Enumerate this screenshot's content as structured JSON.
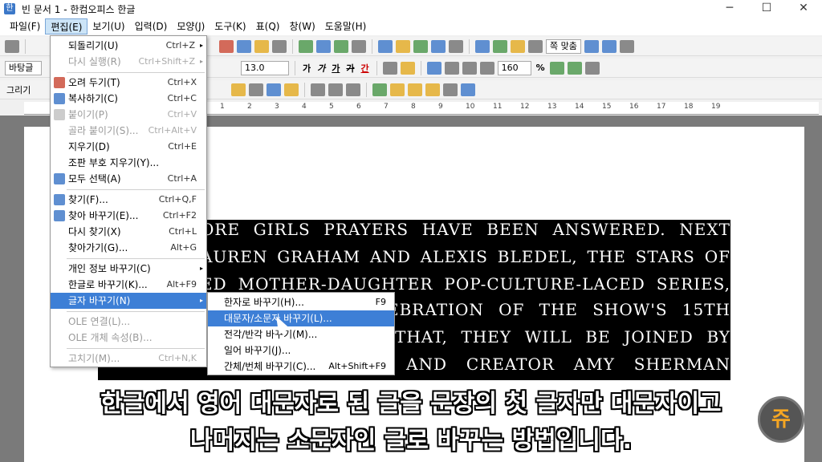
{
  "window": {
    "title": "빈 문서 1 - 한컴오피스 한글",
    "minimize": "─",
    "maximize": "☐",
    "close": "✕"
  },
  "menubar": [
    "파일(F)",
    "편집(E)",
    "보기(U)",
    "입력(D)",
    "모양(J)",
    "도구(K)",
    "표(Q)",
    "창(W)",
    "도움말(H)"
  ],
  "toolbar": {
    "zoom_combo": "쪽 맞춤",
    "style_combo": "바탕글",
    "font_size": "13.0",
    "bold": "가",
    "italic": "가",
    "underline": "가",
    "strike": "가",
    "color": "간",
    "line_spacing": "160",
    "percent": "%",
    "draw": "그리기"
  },
  "ruler_labels": [
    "1",
    "2",
    "3",
    "4",
    "5",
    "6",
    "7",
    "8",
    "9",
    "10",
    "11",
    "12",
    "13",
    "14",
    "15",
    "16",
    "17",
    "18",
    "19"
  ],
  "document": {
    "lines": [
      "ORE GIRLS PRAYERS HAVE BEEN ANSWERED. NEXT",
      "AUREN GRAHAM AND ALEXIS BLEDEL, THE STARS OF",
      "ED MOTHER-DAUGHTER POP-CULTURE-LACED SERIES,",
      "EBRATION OF THE SHOW'S 15TH",
      "THAT, THEY WILL BE JOINED BY",
      "AND CREATOR AMY SHERMAN"
    ]
  },
  "edit_menu": {
    "items": [
      {
        "label": "되돌리기(U)",
        "shortcut": "Ctrl+Z",
        "arrow": "▸"
      },
      {
        "label": "다시 실행(R)",
        "shortcut": "Ctrl+Shift+Z",
        "arrow": "▸",
        "disabled": true
      },
      {
        "label": "오려 두기(T)",
        "shortcut": "Ctrl+X"
      },
      {
        "label": "복사하기(C)",
        "shortcut": "Ctrl+C"
      },
      {
        "label": "붙이기(P)",
        "shortcut": "Ctrl+V",
        "disabled": true
      },
      {
        "label": "골라 붙이기(S)...",
        "shortcut": "Ctrl+Alt+V",
        "disabled": true
      },
      {
        "label": "지우기(D)",
        "shortcut": "Ctrl+E"
      },
      {
        "label": "조판 부호 지우기(Y)..."
      },
      {
        "label": "모두 선택(A)",
        "shortcut": "Ctrl+A"
      },
      {
        "label": "찾기(F)...",
        "shortcut": "Ctrl+Q,F"
      },
      {
        "label": "찾아 바꾸기(E)...",
        "shortcut": "Ctrl+F2"
      },
      {
        "label": "다시 찾기(X)",
        "shortcut": "Ctrl+L"
      },
      {
        "label": "찾아가기(G)...",
        "shortcut": "Alt+G"
      },
      {
        "label": "개인 정보 바꾸기(C)",
        "arrow": "▸"
      },
      {
        "label": "한글로 바꾸기(K)...",
        "shortcut": "Alt+F9"
      },
      {
        "label": "글자 바꾸기(N)",
        "arrow": "▸",
        "highlight": true
      },
      {
        "label": "OLE 연결(L)...",
        "disabled": true
      },
      {
        "label": "OLE 개체 속성(B)...",
        "disabled": true
      },
      {
        "label": "고치기(M)...",
        "shortcut": "Ctrl+N,K",
        "disabled": true
      }
    ]
  },
  "sub_menu": {
    "items": [
      {
        "label": "한자로 바꾸기(H)...",
        "shortcut": "F9"
      },
      {
        "label": "대문자/소문자 바꾸기(L)...",
        "highlight": true
      },
      {
        "label": "전각/반각 바꾸기(M)..."
      },
      {
        "label": "일어 바꾸기(J)..."
      },
      {
        "label": "간체/번체 바꾸기(C)...",
        "shortcut": "Alt+Shift+F9"
      }
    ]
  },
  "subtitles": {
    "line1": "한글에서 영어 대문자로 된 글을 문장의 첫 글자만 대문자이고",
    "line2": "나머지는 소문자인 글로 바꾸는 방법입니다."
  },
  "channel_logo": "쥬"
}
